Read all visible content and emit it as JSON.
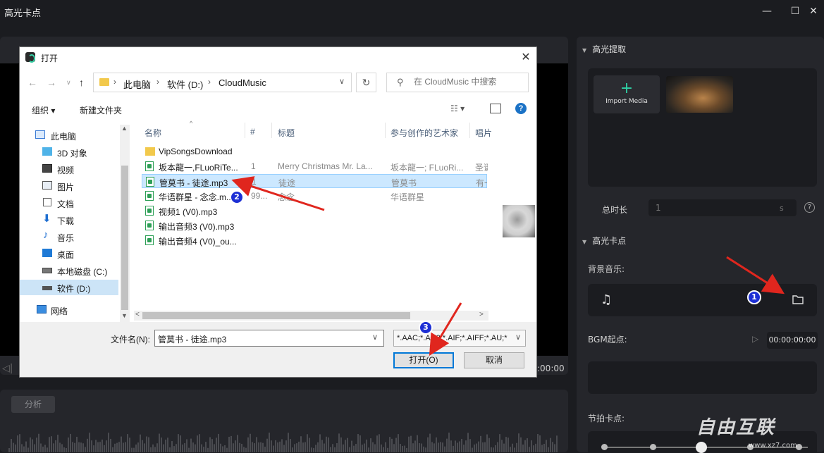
{
  "app": {
    "title": "高光卡点",
    "win_min": "—",
    "win_max": "☐",
    "win_close": "✕"
  },
  "editor": {
    "timecode_left": "◁|",
    "timecode_right": ":00:00",
    "analyze_button": "分析"
  },
  "right_panel": {
    "highlight_extract": "高光提取",
    "import_media": "Import Media",
    "import_plus": "+",
    "total_duration_label": "总时长",
    "total_duration_value": "1",
    "total_duration_unit": "s",
    "help": "?",
    "highlight_beat": "高光卡点",
    "bgm_label": "背景音乐:",
    "bgm_start_label": "BGM起点:",
    "bgm_start_value": "00:00:00:00",
    "beat_label": "节拍卡点:",
    "beat_level": 0.47
  },
  "dialog": {
    "title": "打开",
    "close": "✕",
    "breadcrumbs": [
      "此电脑",
      "软件 (D:)",
      "CloudMusic"
    ],
    "search_placeholder": "在 CloudMusic 中搜索",
    "toolbar": {
      "organize": "组织 ▾",
      "new_folder": "新建文件夹"
    },
    "nav_items": [
      {
        "label": "此电脑",
        "icon": "computer-icon"
      },
      {
        "label": "3D 对象",
        "icon": "3d-objects-icon"
      },
      {
        "label": "视频",
        "icon": "video-icon"
      },
      {
        "label": "图片",
        "icon": "picture-icon"
      },
      {
        "label": "文档",
        "icon": "document-icon"
      },
      {
        "label": "下载",
        "icon": "download-icon"
      },
      {
        "label": "音乐",
        "icon": "music-icon"
      },
      {
        "label": "桌面",
        "icon": "desktop-icon"
      },
      {
        "label": "本地磁盘 (C:)",
        "icon": "drive-icon"
      },
      {
        "label": "软件 (D:)",
        "icon": "drive-icon"
      },
      {
        "label": "网络",
        "icon": "network-icon"
      }
    ],
    "columns": [
      "名称",
      "#",
      "标题",
      "参与创作的艺术家",
      "唱片"
    ],
    "files": [
      {
        "name": "VipSongsDownload",
        "num": "",
        "title": "",
        "artist": "",
        "album": "",
        "type": "folder"
      },
      {
        "name": "坂本龍一,FLuoRiTe...",
        "num": "1",
        "title": "Merry Christmas Mr. La...",
        "artist": "坂本龍一; FLuoRi...",
        "album": "圣诞",
        "type": "audio"
      },
      {
        "name": "管莫书 - 徒途.mp3",
        "num": "1",
        "title": "徒途",
        "artist": "管莫书",
        "album": "有一",
        "type": "audio"
      },
      {
        "name": "华语群星 - 念念.m...",
        "num": "99...",
        "title": "念念",
        "artist": "华语群星",
        "album": "",
        "type": "audio"
      },
      {
        "name": "视频1 (V0).mp3",
        "num": "",
        "title": "",
        "artist": "",
        "album": "",
        "type": "audio"
      },
      {
        "name": "输出音频3 (V0).mp3",
        "num": "",
        "title": "",
        "artist": "",
        "album": "",
        "type": "audio"
      },
      {
        "name": "输出音频4 (V0)_ou...",
        "num": "",
        "title": "",
        "artist": "",
        "album": "",
        "type": "audio"
      }
    ],
    "filename_label": "文件名(N):",
    "filename_value": "管莫书 - 徒途.mp3",
    "filetype_value": "*.AAC;*.AC3;*.AIF;*.AIFF;*.AU;*",
    "open_button": "打开(O)",
    "cancel_button": "取消"
  },
  "annotations": [
    "1",
    "2",
    "3"
  ],
  "watermark": {
    "text": "自由互联",
    "sub": "www.xz7.com"
  }
}
